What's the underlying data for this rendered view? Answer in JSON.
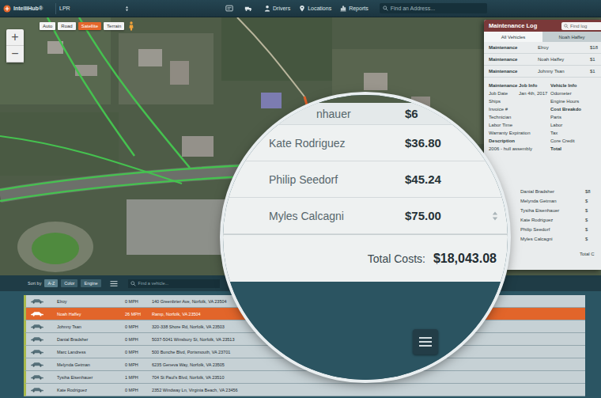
{
  "app": {
    "logo": "IntelliHub®",
    "account": "LPR"
  },
  "nav": [
    {
      "label": "Drivers",
      "kind": "drivers"
    },
    {
      "label": "Locations",
      "kind": "locations"
    },
    {
      "label": "Reports",
      "kind": "reports"
    }
  ],
  "search": {
    "placeholder": "Find an Address..."
  },
  "map": {
    "zoom": [
      "+",
      "−"
    ],
    "types": [
      {
        "label": "Auto",
        "selected": false
      },
      {
        "label": "Road",
        "selected": false
      },
      {
        "label": "Satellite",
        "selected": true
      },
      {
        "label": "Terrain",
        "selected": false
      }
    ]
  },
  "maintenance_log": {
    "title": "Maintenance Log",
    "search": {
      "placeholder": "Find log"
    },
    "tabs": [
      {
        "label": "All Vehicles",
        "selected": true
      },
      {
        "label": "Noah Haffey",
        "selected": false
      }
    ],
    "entries": [
      {
        "type": "Maintenance",
        "name": "Elroy",
        "cost": "$18"
      },
      {
        "type": "Maintenance",
        "name": "Noah Haffey",
        "cost": "$1"
      },
      {
        "type": "Maintenance",
        "name": "Johnny Tsan",
        "cost": "$1"
      }
    ],
    "job_info": {
      "title": "Maintenance Job Info",
      "fields": [
        {
          "label": "Job Date",
          "value": "Jan 4th, 2017"
        },
        {
          "label": "Ships"
        },
        {
          "label": "Invoice #"
        },
        {
          "label": "Technician"
        },
        {
          "label": "Labor Time"
        },
        {
          "label": "Warranty Expiration"
        }
      ],
      "description_label": "Description",
      "description": "2006 - hull assembly"
    },
    "vehicle_info": {
      "title": "Vehicle Info",
      "fields": [
        "Odometer",
        "Engine Hours"
      ]
    },
    "cost_breakdown": {
      "title": "Cost Breakdo",
      "fields": [
        "Parts",
        "Labor",
        "Tax",
        "Core Credit"
      ],
      "total_label": "Total"
    },
    "driver_costs": [
      {
        "name": "Danial Bradsher",
        "cost": "$8"
      },
      {
        "name": "Melynda Getman",
        "cost": "$"
      },
      {
        "name": "Tysiha Eisenhauer",
        "cost": "$"
      },
      {
        "name": "Kate Rodriguez",
        "cost": "$"
      },
      {
        "name": "Philip Seedorf",
        "cost": "$"
      },
      {
        "name": "Myles Calcagni",
        "cost": "$"
      }
    ],
    "total_label": "Total C"
  },
  "magnifier": {
    "rows": [
      {
        "name": "nhauer",
        "cost": "$6"
      },
      {
        "name": "Kate Rodriguez",
        "cost": "$36.80"
      },
      {
        "name": "Philip Seedorf",
        "cost": "$45.24"
      },
      {
        "name": "Myles Calcagni",
        "cost": "$75.00"
      }
    ],
    "total_label": "Total Costs:",
    "total": "$18,043.08"
  },
  "vehicles": {
    "toolbar": {
      "sort_label": "Sort by",
      "sorts": [
        {
          "label": "A-Z",
          "selected": true
        },
        {
          "label": "Color",
          "selected": false
        },
        {
          "label": "Engine",
          "selected": false
        }
      ],
      "search": {
        "placeholder": "Find a vehicle..."
      }
    },
    "rows": [
      {
        "name": "Elroy",
        "speed": "0 MPH",
        "address": "140 Greenbrier Ave, Norfolk, VA 23504",
        "selected": false
      },
      {
        "name": "Noah Haffey",
        "speed": "26 MPH",
        "address": "Ramp, Norfolk, VA 23504",
        "selected": true
      },
      {
        "name": "Johnny Tsan",
        "speed": "0 MPH",
        "address": "320-338 Shore Rd, Norfolk, VA 23503",
        "selected": false
      },
      {
        "name": "Danial Bradsher",
        "speed": "0 MPH",
        "address": "5037-5041 Winsbury St, Norfolk, VA 23513",
        "selected": false
      },
      {
        "name": "Marc Landress",
        "speed": "0 MPH",
        "address": "500 Bunche Blvd, Portsmouth, VA 23701",
        "selected": false
      },
      {
        "name": "Melynda Getman",
        "speed": "0 MPH",
        "address": "6235 Geneva Way, Norfolk, VA 23505",
        "selected": false
      },
      {
        "name": "Tysiha Eisenhauer",
        "speed": "1 MPH",
        "address": "704 St Paul's Blvd, Norfolk, VA 23510",
        "selected": false
      },
      {
        "name": "Kate Rodriguez",
        "speed": "0 MPH",
        "address": "2352 Windway Ln, Virginia Beach, VA 23456",
        "selected": false
      }
    ]
  }
}
